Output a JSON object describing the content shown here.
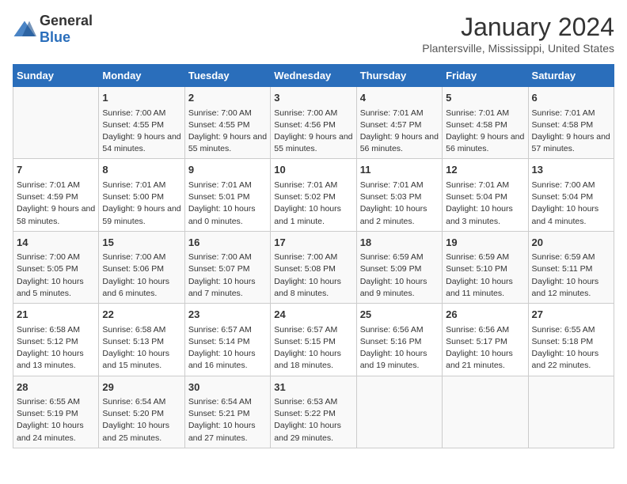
{
  "header": {
    "logo_general": "General",
    "logo_blue": "Blue",
    "month": "January 2024",
    "location": "Plantersville, Mississippi, United States"
  },
  "weekdays": [
    "Sunday",
    "Monday",
    "Tuesday",
    "Wednesday",
    "Thursday",
    "Friday",
    "Saturday"
  ],
  "weeks": [
    [
      {
        "day": null
      },
      {
        "day": "1",
        "sunrise": "7:00 AM",
        "sunset": "4:55 PM",
        "daylight": "9 hours and 54 minutes."
      },
      {
        "day": "2",
        "sunrise": "7:00 AM",
        "sunset": "4:55 PM",
        "daylight": "9 hours and 55 minutes."
      },
      {
        "day": "3",
        "sunrise": "7:00 AM",
        "sunset": "4:56 PM",
        "daylight": "9 hours and 55 minutes."
      },
      {
        "day": "4",
        "sunrise": "7:01 AM",
        "sunset": "4:57 PM",
        "daylight": "9 hours and 56 minutes."
      },
      {
        "day": "5",
        "sunrise": "7:01 AM",
        "sunset": "4:58 PM",
        "daylight": "9 hours and 56 minutes."
      },
      {
        "day": "6",
        "sunrise": "7:01 AM",
        "sunset": "4:58 PM",
        "daylight": "9 hours and 57 minutes."
      }
    ],
    [
      {
        "day": "7",
        "sunrise": "7:01 AM",
        "sunset": "4:59 PM",
        "daylight": "9 hours and 58 minutes."
      },
      {
        "day": "8",
        "sunrise": "7:01 AM",
        "sunset": "5:00 PM",
        "daylight": "9 hours and 59 minutes."
      },
      {
        "day": "9",
        "sunrise": "7:01 AM",
        "sunset": "5:01 PM",
        "daylight": "10 hours and 0 minutes."
      },
      {
        "day": "10",
        "sunrise": "7:01 AM",
        "sunset": "5:02 PM",
        "daylight": "10 hours and 1 minute."
      },
      {
        "day": "11",
        "sunrise": "7:01 AM",
        "sunset": "5:03 PM",
        "daylight": "10 hours and 2 minutes."
      },
      {
        "day": "12",
        "sunrise": "7:01 AM",
        "sunset": "5:04 PM",
        "daylight": "10 hours and 3 minutes."
      },
      {
        "day": "13",
        "sunrise": "7:00 AM",
        "sunset": "5:04 PM",
        "daylight": "10 hours and 4 minutes."
      }
    ],
    [
      {
        "day": "14",
        "sunrise": "7:00 AM",
        "sunset": "5:05 PM",
        "daylight": "10 hours and 5 minutes."
      },
      {
        "day": "15",
        "sunrise": "7:00 AM",
        "sunset": "5:06 PM",
        "daylight": "10 hours and 6 minutes."
      },
      {
        "day": "16",
        "sunrise": "7:00 AM",
        "sunset": "5:07 PM",
        "daylight": "10 hours and 7 minutes."
      },
      {
        "day": "17",
        "sunrise": "7:00 AM",
        "sunset": "5:08 PM",
        "daylight": "10 hours and 8 minutes."
      },
      {
        "day": "18",
        "sunrise": "6:59 AM",
        "sunset": "5:09 PM",
        "daylight": "10 hours and 9 minutes."
      },
      {
        "day": "19",
        "sunrise": "6:59 AM",
        "sunset": "5:10 PM",
        "daylight": "10 hours and 11 minutes."
      },
      {
        "day": "20",
        "sunrise": "6:59 AM",
        "sunset": "5:11 PM",
        "daylight": "10 hours and 12 minutes."
      }
    ],
    [
      {
        "day": "21",
        "sunrise": "6:58 AM",
        "sunset": "5:12 PM",
        "daylight": "10 hours and 13 minutes."
      },
      {
        "day": "22",
        "sunrise": "6:58 AM",
        "sunset": "5:13 PM",
        "daylight": "10 hours and 15 minutes."
      },
      {
        "day": "23",
        "sunrise": "6:57 AM",
        "sunset": "5:14 PM",
        "daylight": "10 hours and 16 minutes."
      },
      {
        "day": "24",
        "sunrise": "6:57 AM",
        "sunset": "5:15 PM",
        "daylight": "10 hours and 18 minutes."
      },
      {
        "day": "25",
        "sunrise": "6:56 AM",
        "sunset": "5:16 PM",
        "daylight": "10 hours and 19 minutes."
      },
      {
        "day": "26",
        "sunrise": "6:56 AM",
        "sunset": "5:17 PM",
        "daylight": "10 hours and 21 minutes."
      },
      {
        "day": "27",
        "sunrise": "6:55 AM",
        "sunset": "5:18 PM",
        "daylight": "10 hours and 22 minutes."
      }
    ],
    [
      {
        "day": "28",
        "sunrise": "6:55 AM",
        "sunset": "5:19 PM",
        "daylight": "10 hours and 24 minutes."
      },
      {
        "day": "29",
        "sunrise": "6:54 AM",
        "sunset": "5:20 PM",
        "daylight": "10 hours and 25 minutes."
      },
      {
        "day": "30",
        "sunrise": "6:54 AM",
        "sunset": "5:21 PM",
        "daylight": "10 hours and 27 minutes."
      },
      {
        "day": "31",
        "sunrise": "6:53 AM",
        "sunset": "5:22 PM",
        "daylight": "10 hours and 29 minutes."
      },
      {
        "day": null
      },
      {
        "day": null
      },
      {
        "day": null
      }
    ]
  ]
}
